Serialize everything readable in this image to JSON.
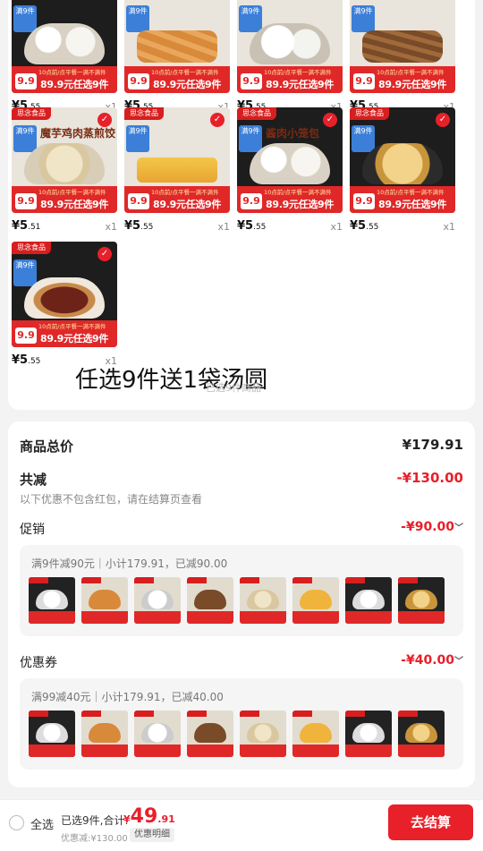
{
  "products": [
    {
      "brand": "思念食品",
      "price_int": "5",
      "price_dec": ".55",
      "qty": "x1",
      "style": "bun",
      "title": "",
      "checked": false,
      "dark": true
    },
    {
      "brand": "思念食品",
      "price_int": "5",
      "price_dec": ".55",
      "qty": "x1",
      "style": "roll",
      "title": "",
      "checked": false,
      "dark": false
    },
    {
      "brand": "思念食品",
      "price_int": "5",
      "price_dec": ".55",
      "qty": "x1",
      "style": "white",
      "title": "",
      "checked": false,
      "dark": false
    },
    {
      "brand": "思念食品",
      "price_int": "5",
      "price_dec": ".55",
      "qty": "x1",
      "style": "brown",
      "title": "",
      "checked": false,
      "dark": false
    },
    {
      "brand": "思念食品",
      "price_int": "5",
      "price_dec": ".51",
      "qty": "x1",
      "style": "dump",
      "title": "魔芋鸡肉蒸煎饺",
      "checked": true,
      "dark": false
    },
    {
      "brand": "思念食品",
      "price_int": "5",
      "price_dec": ".55",
      "qty": "x1",
      "style": "spring",
      "title": "",
      "checked": true,
      "dark": false
    },
    {
      "brand": "思念食品",
      "price_int": "5",
      "price_dec": ".55",
      "qty": "x1",
      "style": "bun",
      "title": "酱肉小笼包",
      "checked": true,
      "dark": true
    },
    {
      "brand": "思念食品",
      "price_int": "5",
      "price_dec": ".55",
      "qty": "x1",
      "style": "pancake",
      "title": "",
      "checked": true,
      "dark": true
    },
    {
      "brand": "思念食品",
      "price_int": "5",
      "price_dec": ".55",
      "qty": "x1",
      "style": "redbean",
      "title": "",
      "checked": true,
      "dark": true
    }
  ],
  "promo_badge": {
    "nine": "9.9",
    "top_text": "10点前/点平餐一满不满件",
    "main_text": "89.9元任选9件",
    "tag_top": "满9件"
  },
  "currency": "¥",
  "gift_text": "任选9件送1袋汤圆",
  "gift_sub": "已选9件商品",
  "summary": {
    "total_label": "商品总价",
    "total_value": "¥179.91",
    "reduce_label": "共减",
    "reduce_value": "-¥130.00",
    "reduce_note": "以下优惠不包含红包，请在结算页查看",
    "promo_label": "促销",
    "promo_value": "-¥90.00",
    "promo_detail": "满9件减90元｜小计179.91，已减90.00",
    "coupon_label": "优惠券",
    "coupon_value": "-¥40.00",
    "coupon_detail": "满99减40元｜小计179.91，已减40.00",
    "chevron": "﹀"
  },
  "footer": {
    "select_all": "全选",
    "selected": "已选9件,合计:",
    "currency": "¥",
    "total_int": "49",
    "total_dec": ".91",
    "saved": "优惠减:¥130.00",
    "detail": "优惠明细",
    "pay": "去结算"
  },
  "colors": {
    "accent": "#e8202a",
    "promo_bg": "#e02828",
    "page_bg": "#f3f3f3"
  }
}
